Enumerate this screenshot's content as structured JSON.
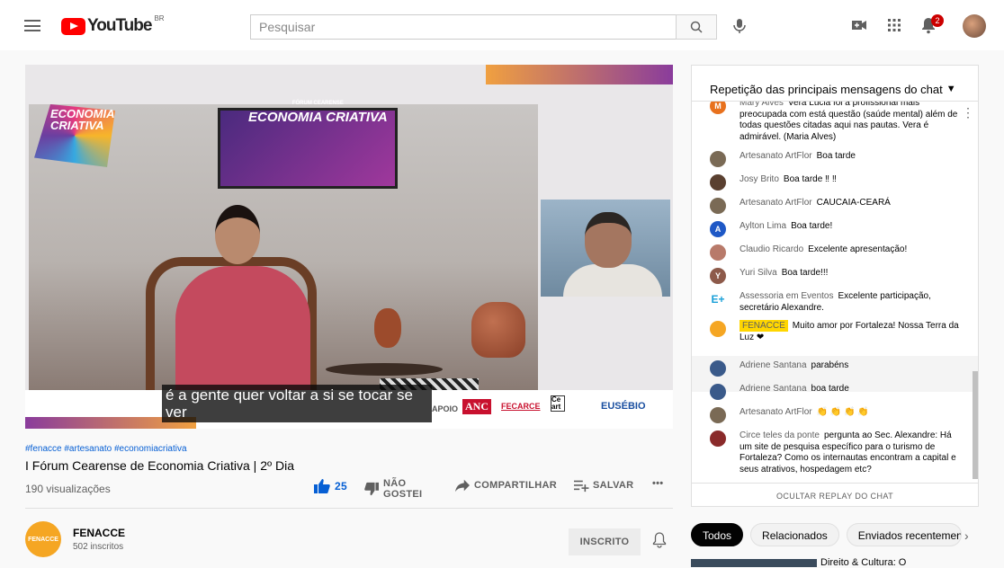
{
  "header": {
    "logo_text": "YouTube",
    "country": "BR",
    "search_placeholder": "Pesquisar",
    "notification_count": "2"
  },
  "video": {
    "tv_title": "ECONOMIA CRIATIVA",
    "tv_subtitle": "FÓRUM CEARENSE",
    "logo_left": "ECONOMIA CRIATIVA",
    "caption": "é a gente quer voltar a si se tocar se ver",
    "sponsors": [
      "APOIO",
      "ANC",
      "FECARCE",
      "Ce art",
      "EUSÉBIO"
    ]
  },
  "info": {
    "tags": "#fenacce #artesanato #economiacriativa",
    "title": "I Fórum Cearense de Economia Criativa | 2º Dia",
    "views": "190 visualizações",
    "like_count": "25",
    "dislike_label": "NÃO GOSTEI",
    "share_label": "COMPARTILHAR",
    "save_label": "SALVAR",
    "more_label": "•••"
  },
  "channel": {
    "avatar_text": "FENACCE",
    "name": "FENACCE",
    "subs": "502 inscritos",
    "subscribe_label": "INSCRITO"
  },
  "chat": {
    "header": "Repetição das principais mensagens do chat",
    "footer": "OCULTAR REPLAY DO CHAT",
    "messages": [
      {
        "author": "Mary Alves",
        "text": "Vera Lúcia foi a profissional mais preocupada com está questão (saúde mental) além de todas questões citadas aqui nas pautas. Vera é admirável. (Maria Alves)",
        "initial": "M",
        "color": "#e8711d"
      },
      {
        "author": "Artesanato ArtFlor",
        "text": "Boa tarde",
        "initial": "",
        "color": "#7a6a55"
      },
      {
        "author": "Josy Brito",
        "text": "Boa tarde ‼ ‼",
        "initial": "",
        "color": "#5a4030"
      },
      {
        "author": "Artesanato ArtFlor",
        "text": "CAUCAIA-CEARÁ",
        "initial": "",
        "color": "#7a6a55"
      },
      {
        "author": "Aylton Lima",
        "text": "Boa tarde!",
        "initial": "A",
        "color": "#1e58c6"
      },
      {
        "author": "Claudio Ricardo",
        "text": "Excelente apresentação!",
        "initial": "",
        "color": "#b87a6a"
      },
      {
        "author": "Yuri Silva",
        "text": "Boa tarde!!!",
        "initial": "Y",
        "color": "#8d5a4a"
      },
      {
        "author": "Assessoria em Eventos",
        "text": "Excelente participação, secretário Alexandre.",
        "initial": "E+",
        "color": "#ffffff"
      },
      {
        "author": "FENACCE",
        "text": "Muito amor por Fortaleza! Nossa Terra da Luz ❤",
        "initial": "",
        "color": "#f5a623"
      },
      {
        "author": "Adriene Santana",
        "text": "parabéns",
        "initial": "",
        "color": "#3a5a8a"
      },
      {
        "author": "Adriene Santana",
        "text": "boa tarde",
        "initial": "",
        "color": "#3a5a8a"
      },
      {
        "author": "Artesanato ArtFlor",
        "text": "👏 👏 👏 👏",
        "initial": "",
        "color": "#7a6a55"
      },
      {
        "author": "Circe teles da ponte",
        "text": "pergunta ao Sec. Alexandre: Há um site de pesquisa específico para o turismo de Fortaleza? Como os internautas encontram a capital e seus atrativos, hospedagem etc?",
        "initial": "",
        "color": "#8a2a2a"
      }
    ]
  },
  "chips": [
    "Todos",
    "Relacionados",
    "Enviados recentemente"
  ],
  "peek_title": "Direito & Cultura: O"
}
